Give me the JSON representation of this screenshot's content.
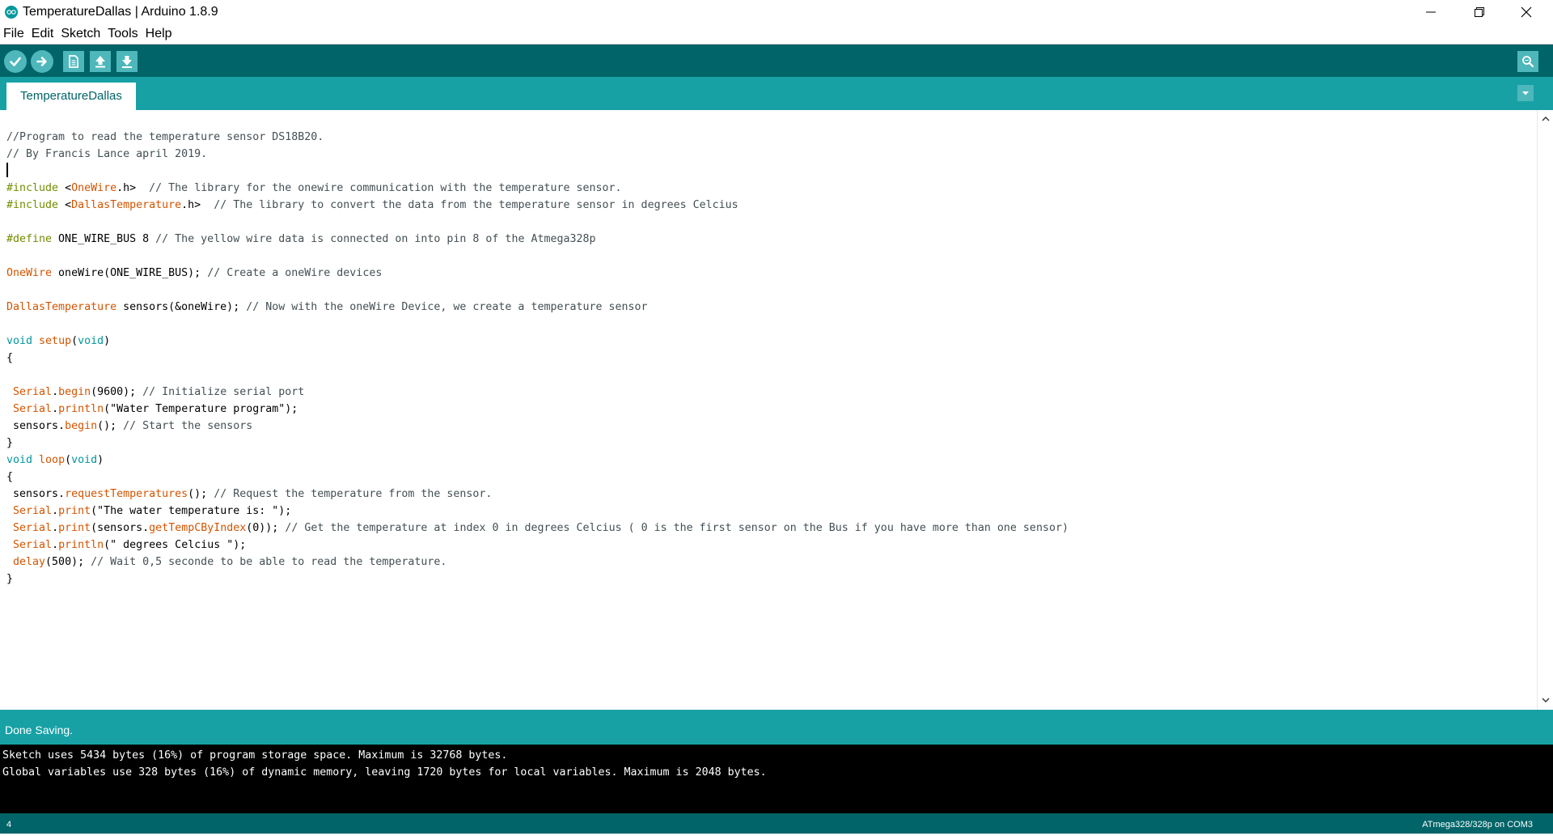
{
  "window": {
    "title": "TemperatureDallas | Arduino 1.8.9",
    "icon": "arduino-logo-icon"
  },
  "menu": [
    "File",
    "Edit",
    "Sketch",
    "Tools",
    "Help"
  ],
  "toolbar": {
    "buttons": [
      {
        "name": "verify",
        "icon": "check-icon"
      },
      {
        "name": "upload",
        "icon": "arrow-right-icon"
      },
      {
        "name": "new",
        "icon": "new-file-icon"
      },
      {
        "name": "open",
        "icon": "arrow-up-icon"
      },
      {
        "name": "save",
        "icon": "arrow-down-icon"
      }
    ],
    "serial_monitor_icon": "serial-monitor-icon"
  },
  "tabs": [
    {
      "label": "TemperatureDallas",
      "active": true
    }
  ],
  "editor": {
    "lines": [
      [
        {
          "t": "//Program to read the temperature sensor DS18B20.",
          "c": "comment"
        }
      ],
      [
        {
          "t": "// By Francis Lance april 2019.",
          "c": "comment"
        }
      ],
      [
        {
          "t": "",
          "c": "plain"
        }
      ],
      [
        {
          "t": "#include ",
          "c": "pre"
        },
        {
          "t": "<",
          "c": "plain"
        },
        {
          "t": "OneWire",
          "c": "lib"
        },
        {
          "t": ".h>  ",
          "c": "plain"
        },
        {
          "t": "// The library for the onewire communication with the temperature sensor.",
          "c": "comment"
        }
      ],
      [
        {
          "t": "#include ",
          "c": "pre"
        },
        {
          "t": "<",
          "c": "plain"
        },
        {
          "t": "DallasTemperature",
          "c": "lib"
        },
        {
          "t": ".h>  ",
          "c": "plain"
        },
        {
          "t": "// The library to convert the data from the temperature sensor in degrees Celcius",
          "c": "comment"
        }
      ],
      [
        {
          "t": "",
          "c": "plain"
        }
      ],
      [
        {
          "t": "#define ",
          "c": "pre"
        },
        {
          "t": "ONE_WIRE_BUS 8 ",
          "c": "plain"
        },
        {
          "t": "// The yellow wire data is connected on into pin 8 of the Atmega328p",
          "c": "comment"
        }
      ],
      [
        {
          "t": "",
          "c": "plain"
        }
      ],
      [
        {
          "t": "OneWire",
          "c": "lib"
        },
        {
          "t": " oneWire(ONE_WIRE_BUS); ",
          "c": "plain"
        },
        {
          "t": "// Create a oneWire devices",
          "c": "comment"
        }
      ],
      [
        {
          "t": "",
          "c": "plain"
        }
      ],
      [
        {
          "t": "DallasTemperature",
          "c": "lib"
        },
        {
          "t": " sensors(&oneWire); ",
          "c": "plain"
        },
        {
          "t": "// Now with the oneWire Device, we create a temperature sensor",
          "c": "comment"
        }
      ],
      [
        {
          "t": "",
          "c": "plain"
        }
      ],
      [
        {
          "t": "void",
          "c": "kw"
        },
        {
          "t": " ",
          "c": "plain"
        },
        {
          "t": "setup",
          "c": "fn"
        },
        {
          "t": "(",
          "c": "plain"
        },
        {
          "t": "void",
          "c": "kw"
        },
        {
          "t": ")",
          "c": "plain"
        }
      ],
      [
        {
          "t": "{",
          "c": "plain"
        }
      ],
      [
        {
          "t": "",
          "c": "plain"
        }
      ],
      [
        {
          "t": " ",
          "c": "plain"
        },
        {
          "t": "Serial",
          "c": "fn"
        },
        {
          "t": ".",
          "c": "plain"
        },
        {
          "t": "begin",
          "c": "fn"
        },
        {
          "t": "(9600); ",
          "c": "plain"
        },
        {
          "t": "// Initialize serial port",
          "c": "comment"
        }
      ],
      [
        {
          "t": " ",
          "c": "plain"
        },
        {
          "t": "Serial",
          "c": "fn"
        },
        {
          "t": ".",
          "c": "plain"
        },
        {
          "t": "println",
          "c": "fn"
        },
        {
          "t": "(\"Water Temperature program\");",
          "c": "plain"
        }
      ],
      [
        {
          "t": " sensors.",
          "c": "plain"
        },
        {
          "t": "begin",
          "c": "fn"
        },
        {
          "t": "(); ",
          "c": "plain"
        },
        {
          "t": "// Start the sensors",
          "c": "comment"
        }
      ],
      [
        {
          "t": "}",
          "c": "plain"
        }
      ],
      [
        {
          "t": "void",
          "c": "kw"
        },
        {
          "t": " ",
          "c": "plain"
        },
        {
          "t": "loop",
          "c": "fn"
        },
        {
          "t": "(",
          "c": "plain"
        },
        {
          "t": "void",
          "c": "kw"
        },
        {
          "t": ")",
          "c": "plain"
        }
      ],
      [
        {
          "t": "{",
          "c": "plain"
        }
      ],
      [
        {
          "t": " sensors.",
          "c": "plain"
        },
        {
          "t": "requestTemperatures",
          "c": "fn"
        },
        {
          "t": "(); ",
          "c": "plain"
        },
        {
          "t": "// Request the temperature from the sensor.",
          "c": "comment"
        }
      ],
      [
        {
          "t": " ",
          "c": "plain"
        },
        {
          "t": "Serial",
          "c": "fn"
        },
        {
          "t": ".",
          "c": "plain"
        },
        {
          "t": "print",
          "c": "fn"
        },
        {
          "t": "(\"The water temperature is: \");",
          "c": "plain"
        }
      ],
      [
        {
          "t": " ",
          "c": "plain"
        },
        {
          "t": "Serial",
          "c": "fn"
        },
        {
          "t": ".",
          "c": "plain"
        },
        {
          "t": "print",
          "c": "fn"
        },
        {
          "t": "(sensors.",
          "c": "plain"
        },
        {
          "t": "getTempCByIndex",
          "c": "fn"
        },
        {
          "t": "(0)); ",
          "c": "plain"
        },
        {
          "t": "// Get the temperature at index 0 in degrees Celcius ( 0 is the first sensor on the Bus if you have more than one sensor)",
          "c": "comment"
        }
      ],
      [
        {
          "t": " ",
          "c": "plain"
        },
        {
          "t": "Serial",
          "c": "fn"
        },
        {
          "t": ".",
          "c": "plain"
        },
        {
          "t": "println",
          "c": "fn"
        },
        {
          "t": "(\" degrees Celcius \");",
          "c": "plain"
        }
      ],
      [
        {
          "t": " ",
          "c": "plain"
        },
        {
          "t": "delay",
          "c": "fn"
        },
        {
          "t": "(500); ",
          "c": "plain"
        },
        {
          "t": "// Wait 0,5 seconde to be able to read the temperature.",
          "c": "comment"
        }
      ],
      [
        {
          "t": "}",
          "c": "plain"
        }
      ]
    ]
  },
  "status": {
    "message": "Done Saving."
  },
  "console": {
    "lines": [
      "Sketch uses 5434 bytes (16%) of program storage space. Maximum is 32768 bytes.",
      "Global variables use 328 bytes (16%) of dynamic memory, leaving 1720 bytes for local variables. Maximum is 2048 bytes."
    ]
  },
  "bottom": {
    "line_number": "4",
    "board": "ATmega328/328p on COM3"
  },
  "colors": {
    "toolbar_bg": "#006468",
    "tabbar_bg": "#17a1a5",
    "button_bg": "#4db7bb",
    "comment": "#434f54",
    "preprocessor": "#728e00",
    "library": "#d35400",
    "keyword": "#00979c"
  }
}
